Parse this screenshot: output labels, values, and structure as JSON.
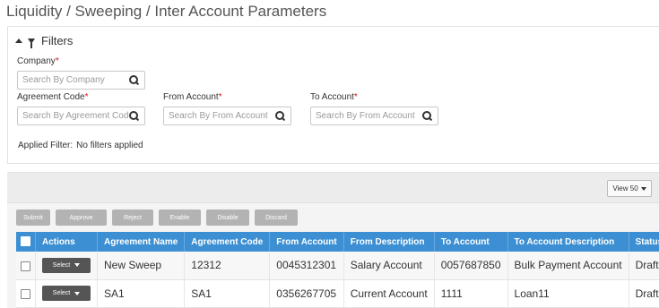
{
  "breadcrumb": "Liquidity / Sweeping / Inter Account Parameters",
  "filters": {
    "title": "Filters",
    "company": {
      "label": "Company",
      "required_mark": "*",
      "placeholder": "Search By Company"
    },
    "agreement_code": {
      "label": "Agreement Code",
      "required_mark": "*",
      "placeholder": "Search By Agreement Code"
    },
    "from_account": {
      "label": "From Account",
      "required_mark": "*",
      "placeholder": "Search By From Account"
    },
    "to_account": {
      "label": "To Account",
      "required_mark": "*",
      "placeholder": "Search By From Account"
    },
    "applied_label": "Applied Filter:",
    "applied_value": "No filters applied"
  },
  "grid": {
    "view_label": "View 50",
    "actions": [
      "Submit",
      "Approve",
      "Reject",
      "Enable",
      "Disable",
      "Discard"
    ],
    "columns": [
      "Actions",
      "Agreement Name",
      "Agreement Code",
      "From Account",
      "From Description",
      "To Account",
      "To Account Description",
      "Status"
    ],
    "select_label": "Select",
    "rows": [
      {
        "agreement_name": "New Sweep",
        "agreement_code": "12312",
        "from_account": "0045312301",
        "from_description": "Salary Account",
        "to_account": "0057687850",
        "to_account_description": "Bulk Payment Account",
        "status": "Draft"
      },
      {
        "agreement_name": "SA1",
        "agreement_code": "SA1",
        "from_account": "0356267705",
        "from_description": "Current Account",
        "to_account": "1111",
        "to_account_description": "Loan11",
        "status": "Draft"
      }
    ]
  },
  "colors": {
    "header_blue": "#3c8fd2",
    "required_red": "#d9141e",
    "disabled_button": "#b3b3b3",
    "select_button": "#555555"
  }
}
